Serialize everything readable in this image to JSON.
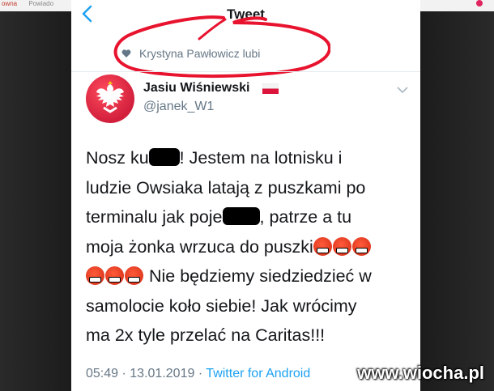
{
  "background": {
    "left_tab_label": "owna",
    "left_tab2_label": "Powiado"
  },
  "nav": {
    "title": "Tweet",
    "back_icon": "chevron-left-icon"
  },
  "social_context": {
    "text": "Krystyna Pawłowicz lubi",
    "icon": "heart-icon"
  },
  "author": {
    "name": "Jasiu Wiśniewski",
    "handle": "@janek_W1",
    "flag": "poland-flag-icon"
  },
  "tweet": {
    "line1_a": "Nosz ku",
    "line1_b": "! Jestem na lotnisku i",
    "line2": "ludzie Owsiaka latają z puszkami po",
    "line3_a": "terminalu jak poje",
    "line3_b": ", patrze a tu",
    "line4": "moja żonka wrzuca do puszki",
    "line5": " Nie będziemy siedziedzieć w",
    "line6": "samolocie koło siebie! Jak wrócimy",
    "line7": "ma 2x tyle przelać na Caritas!!!",
    "emoji_name": "face-with-symbols-on-mouth-icon"
  },
  "meta": {
    "time": "05:49",
    "separator": "·",
    "date": "13.01.2019",
    "source": "Twitter for Android"
  },
  "watermark": "www.wiocha.pl",
  "colors": {
    "accent": "#1da1f2",
    "secondary_text": "#657786",
    "annotation_red": "#e8132e"
  }
}
